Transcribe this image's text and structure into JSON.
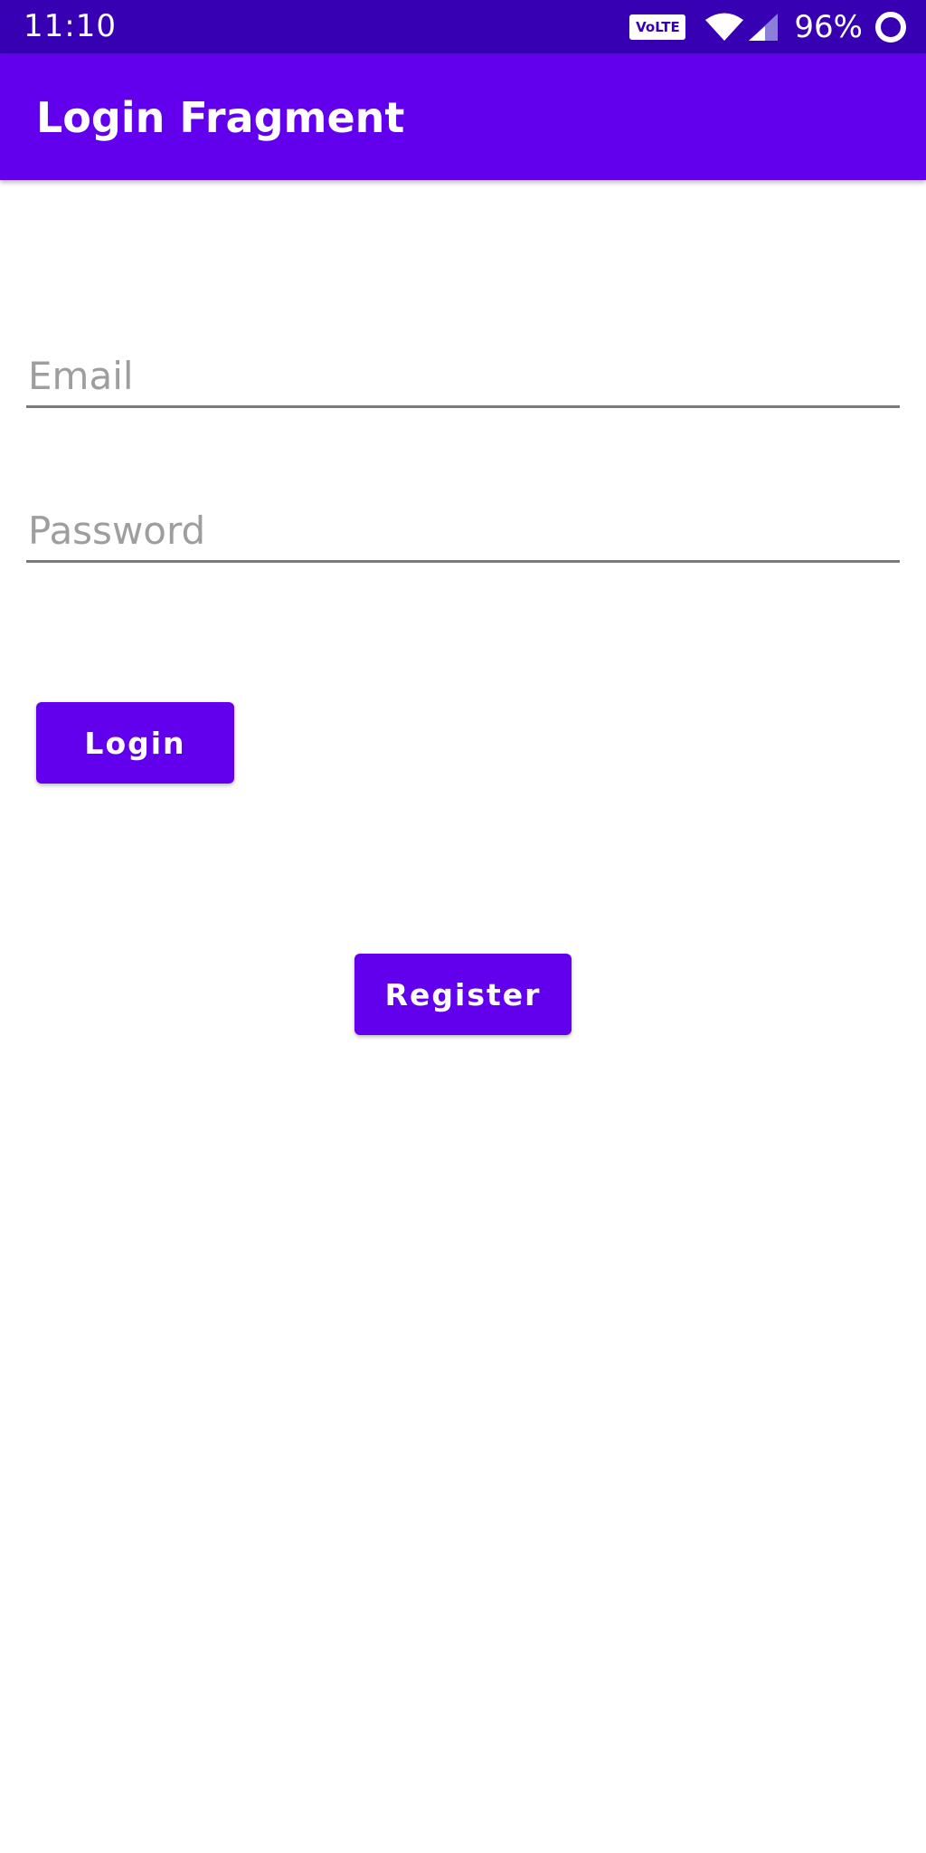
{
  "status_bar": {
    "time": "11:10",
    "volte": "VoLTE",
    "battery": "96%",
    "icons": [
      "volte-badge",
      "wifi-icon",
      "cell-signal-icon",
      "battery-ring-icon"
    ]
  },
  "app_bar": {
    "title": "Login Fragment"
  },
  "form": {
    "email_placeholder": "Email",
    "email_value": "",
    "password_placeholder": "Password",
    "password_value": "",
    "login_label": "Login",
    "register_label": "Register"
  },
  "colors": {
    "status_bar": "#3700b3",
    "primary": "#6200ee",
    "underline": "#7a7a7a",
    "placeholder": "#9e9e9e"
  }
}
